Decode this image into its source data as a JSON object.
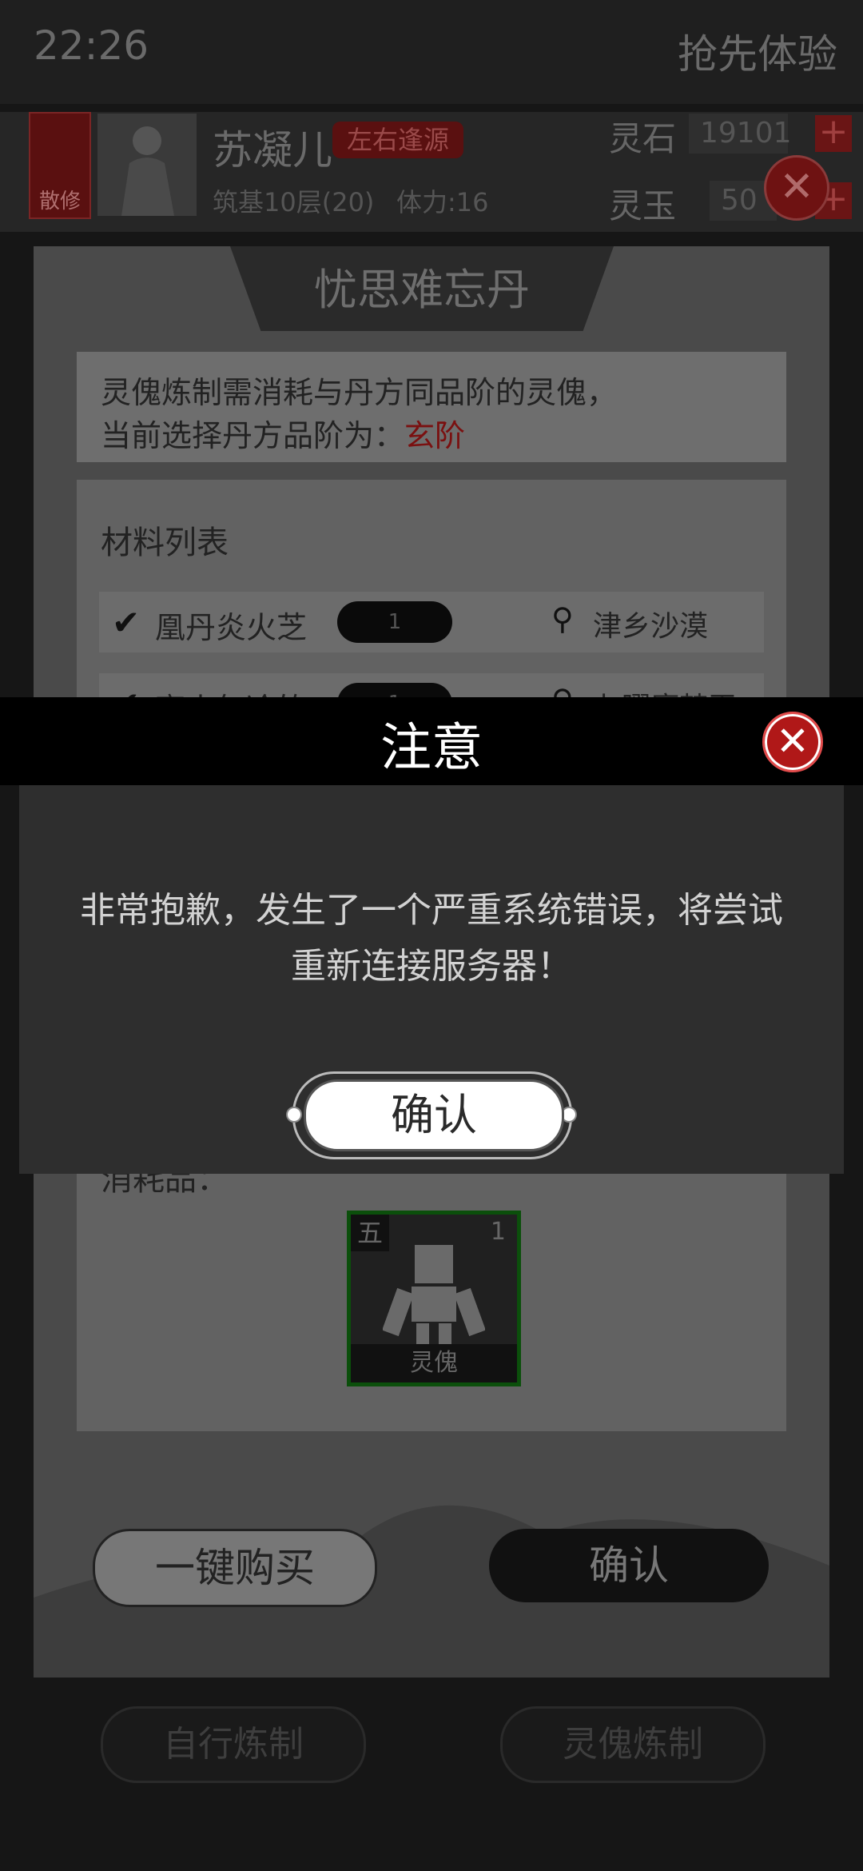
{
  "status_bar": {
    "time": "22:26",
    "early_access": "抢先体验"
  },
  "player": {
    "rank_badge": "散修",
    "name": "苏凝儿",
    "tag": "左右逢源",
    "level": "筑基10层(20)",
    "stamina": "体力:16"
  },
  "resources": [
    {
      "label": "灵石",
      "value": "19101",
      "plus": "+"
    },
    {
      "label": "灵玉",
      "value": "50",
      "plus": "+"
    }
  ],
  "top_close": "✕",
  "panel": {
    "title": "忧思难忘丹",
    "info_line1": "灵傀炼制需消耗与丹方同品阶的灵傀，",
    "info_line2_prefix": "当前选择丹方品阶为：",
    "info_grade": "玄阶",
    "materials_title": "材料列表",
    "materials": [
      {
        "check": "✔",
        "name": "凰丹炎火芝",
        "qty": "1",
        "pin": "⚲",
        "location": "津乡沙漠"
      },
      {
        "check": "✔",
        "name": "离火气冷竹",
        "qty": "1",
        "pin": "⚲",
        "location": "七曜魔梦玉"
      }
    ],
    "cost_label": "消耗品：",
    "cost_item": {
      "grade": "五",
      "count": "1",
      "name": "灵傀"
    },
    "buy_all_button": "一键购买",
    "confirm_button": "确认"
  },
  "bottom_tabs": {
    "self_refine": "自行炼制",
    "puppet_refine": "灵傀炼制"
  },
  "dialog": {
    "title": "注意",
    "close": "✕",
    "message": "非常抱歉，发生了一个严重系统错误，将尝试重新连接服务器！",
    "ok_button": "确认"
  },
  "colors": {
    "dialog_close": "#b01818",
    "grade_text": "#7a1010",
    "item_border": "#0b4f0b"
  }
}
